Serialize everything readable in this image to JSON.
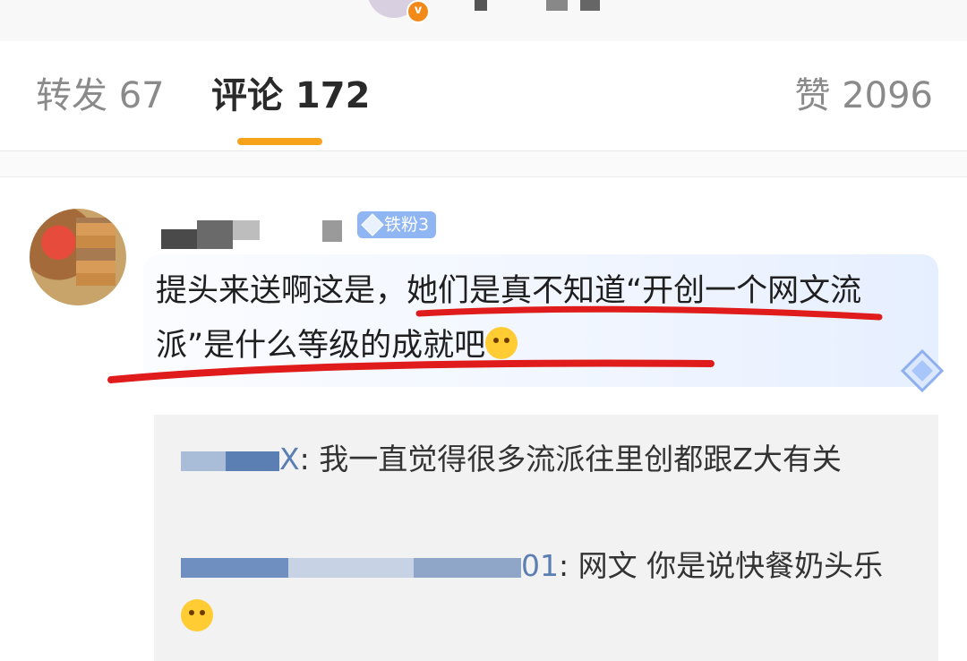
{
  "tabs": {
    "repost": "转发 67",
    "comment": "评论 172",
    "like": "赞 2096"
  },
  "comment": {
    "fan_badge": "铁粉3",
    "text": "提头来送啊这是，她们是真不知道“开创一个网文流派”是什么等级的成就吧",
    "emoji": "rofl-emoji"
  },
  "replies": [
    {
      "name_suffix": "X",
      "text": ": 我一直觉得很多流派往里创都跟Z大有关"
    },
    {
      "name_suffix": "01",
      "text": ": 网文 你是说快餐奶头乐",
      "emoji": "astonished-emoji"
    }
  ],
  "colors": {
    "tab_underline": "#f7a21b",
    "fan_badge": "#8fb6f2",
    "annotation_red": "#e01b1b",
    "reply_name": "#5b7fb3"
  }
}
